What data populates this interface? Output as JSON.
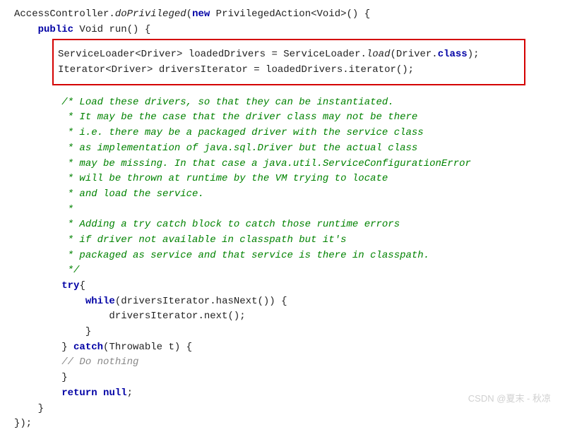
{
  "line1_pre": "AccessController.",
  "line1_method": "doPrivileged",
  "line1_paren": "(",
  "kw_new": "new",
  "line1_post": " PrivilegedAction<Void>() {",
  "kw_public": "public",
  "line2_sig": " Void run() {",
  "hl_line1_a": "ServiceLoader<Driver> loadedDrivers = ServiceLoader.",
  "hl_line1_b": "load",
  "hl_line1_c": "(Driver.",
  "kw_class": "class",
  "hl_line1_d": ");",
  "hl_line2": "Iterator<Driver> driversIterator = loadedDrivers.iterator();",
  "c1": "/* Load these drivers, so that they can be instantiated.",
  "c2": " * It may be the case that the driver class may not be there",
  "c3": " * i.e. there may be a packaged driver with the service class",
  "c4": " * as implementation of java.sql.Driver but the actual class",
  "c5": " * may be missing. In that case a java.util.ServiceConfigurationError",
  "c6": " * will be thrown at runtime by the VM trying to locate",
  "c7": " * and load the service.",
  "c8": " *",
  "c9": " * Adding a try catch block to catch those runtime errors",
  "c10": " * if driver not available in classpath but it's",
  "c11": " * packaged as service and that service is there in classpath.",
  "c12": " */",
  "kw_try": "try",
  "try_brace": "{",
  "kw_while": "while",
  "while_cond": "(driversIterator.hasNext()) {",
  "next_call": "driversIterator.next();",
  "close_brace": "}",
  "catch_open": "} ",
  "kw_catch": "catch",
  "catch_sig": "(Throwable t) {",
  "do_nothing": "// Do nothing",
  "kw_return": "return",
  "kw_null": "null",
  "semi": ";",
  "close_paren": "});",
  "watermark": "CSDN @夏末 - 秋凉"
}
